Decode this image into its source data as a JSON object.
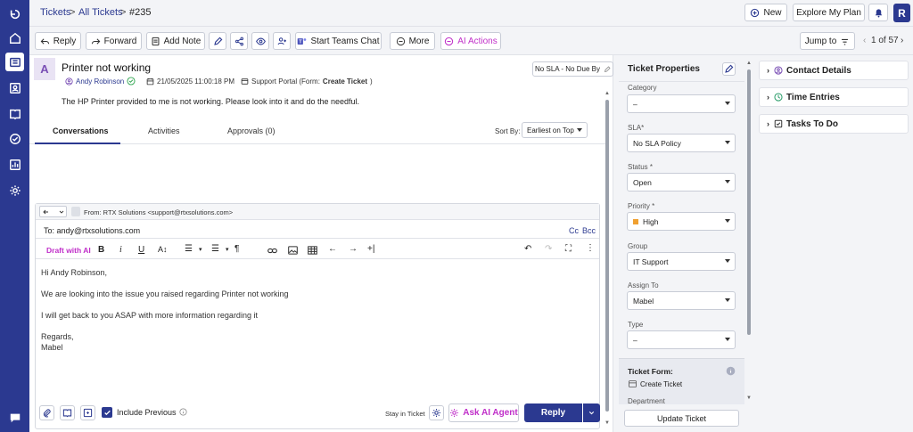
{
  "breadcrumb": {
    "tickets": "Tickets",
    "sep1": ">",
    "all": "All Tickets",
    "sep2": ">",
    "id": "#235"
  },
  "topbar": {
    "new_label": "New",
    "explore_label": "Explore My Plan",
    "avatar_initial": "R"
  },
  "toolbar": {
    "reply": "Reply",
    "forward": "Forward",
    "add_note": "Add Note",
    "teams": "Start Teams Chat",
    "more": "More",
    "ai_actions": "AI Actions",
    "jump_to": "Jump to",
    "pager": "1 of 57"
  },
  "ticket": {
    "avatar": "A",
    "subject": "Printer not working",
    "requester": "Andy Robinson",
    "created": "21/05/2025 11:00:18 PM",
    "source_prefix": "Support Portal (Form: ",
    "source_form": "Create Ticket",
    "source_suffix": ")",
    "sla_badge": "No SLA - No Due By",
    "description": "The HP Printer provided to me is not working. Please look into it and do the needful."
  },
  "tabs": {
    "conversations": "Conversations",
    "activities": "Activities",
    "approvals": "Approvals (0)",
    "sort_label": "Sort By:",
    "sort_value": "Earliest on Top"
  },
  "composer": {
    "from": "From:  RTX Solutions <support@rtxsolutions.com>",
    "to": "To: andy@rtxsolutions.com",
    "cc": "Cc",
    "bcc": "Bcc",
    "draft_ai": "Draft with AI",
    "body": [
      "Hi Andy Robinson,",
      "We are looking into the issue you raised regarding Printer not working",
      "I will get back to you ASAP with more information regarding it",
      "Regards,",
      "Mabel"
    ],
    "include_previous": "Include Previous",
    "stay_in_ticket": "Stay in Ticket",
    "ask_ai": "Ask AI Agent",
    "reply": "Reply"
  },
  "properties": {
    "title": "Ticket Properties",
    "category_label": "Category",
    "category_value": "–",
    "sla_label": "SLA*",
    "sla_value": "No SLA Policy",
    "status_label": "Status *",
    "status_value": "Open",
    "priority_label": "Priority *",
    "priority_value": "High",
    "group_label": "Group",
    "group_value": "IT Support",
    "assign_label": "Assign To",
    "assign_value": "Mabel",
    "type_label": "Type",
    "type_value": "–",
    "form_label": "Ticket Form:",
    "form_value": "Create Ticket",
    "department_label": "Department",
    "update_button": "Update Ticket"
  },
  "right_panel": {
    "contact": "Contact Details",
    "time": "Time Entries",
    "tasks": "Tasks To Do"
  },
  "colors": {
    "brand": "#2b3990",
    "accent_purple": "#c02fc9",
    "priority_high": "#f0a030"
  }
}
